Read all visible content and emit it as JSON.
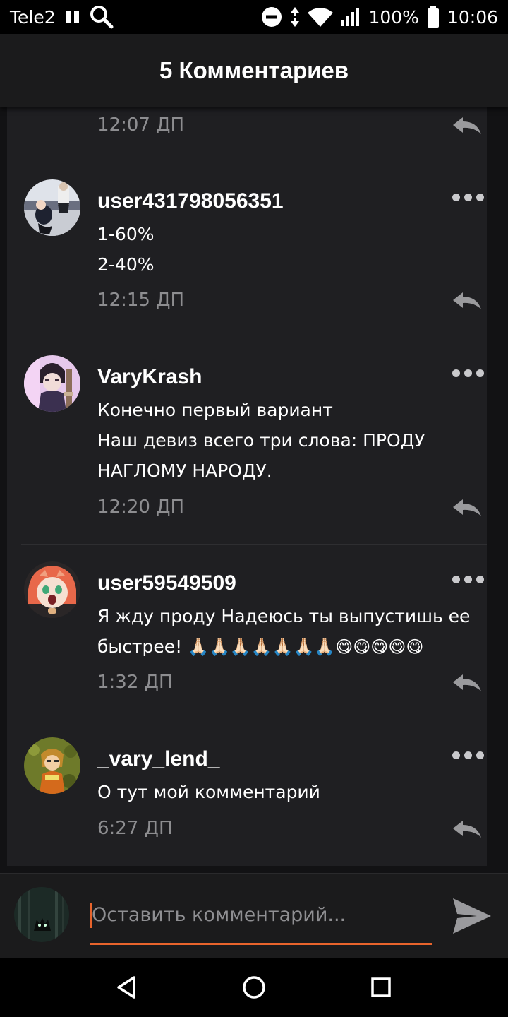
{
  "status_bar": {
    "carrier": "Tele2",
    "battery": "100%",
    "time": "10:06",
    "icons": [
      "sim-card-icon",
      "search-icon",
      "do-not-disturb-icon",
      "data-arrows-icon",
      "wifi-icon",
      "signal-icon",
      "battery-icon"
    ]
  },
  "header": {
    "title": "5 Комментариев"
  },
  "top_partial_comment": {
    "time": "12:07 ДП"
  },
  "comments": [
    {
      "username": "user431798056351",
      "lines": [
        "1-60%",
        "2-40%"
      ],
      "time": "12:15 ДП"
    },
    {
      "username": "VaryKrash",
      "lines": [
        "Конечно первый вариант",
        "Наш девиз всего три слова: ПРОДУ",
        "НАГЛОМУ НАРОДУ."
      ],
      "time": "12:20 ДП"
    },
    {
      "username": "user59549509",
      "lines": [
        "Я жду проду Надеюсь ты выпустишь ее",
        "быстрее!"
      ],
      "emoji": "🙏🏻🙏🏻🙏🏻🙏🏻🙏🏻🙏🏻🙏🏻😋😋😋😋😋",
      "time": "1:32 ДП"
    },
    {
      "username": "_vary_lend_",
      "lines": [
        "О тут мой комментарий"
      ],
      "time": "6:27 ДП"
    }
  ],
  "input": {
    "placeholder": "Оставить комментарий..."
  },
  "colors": {
    "accent": "#e8642c",
    "background": "#1f1f22",
    "header": "#1b1b1c"
  }
}
